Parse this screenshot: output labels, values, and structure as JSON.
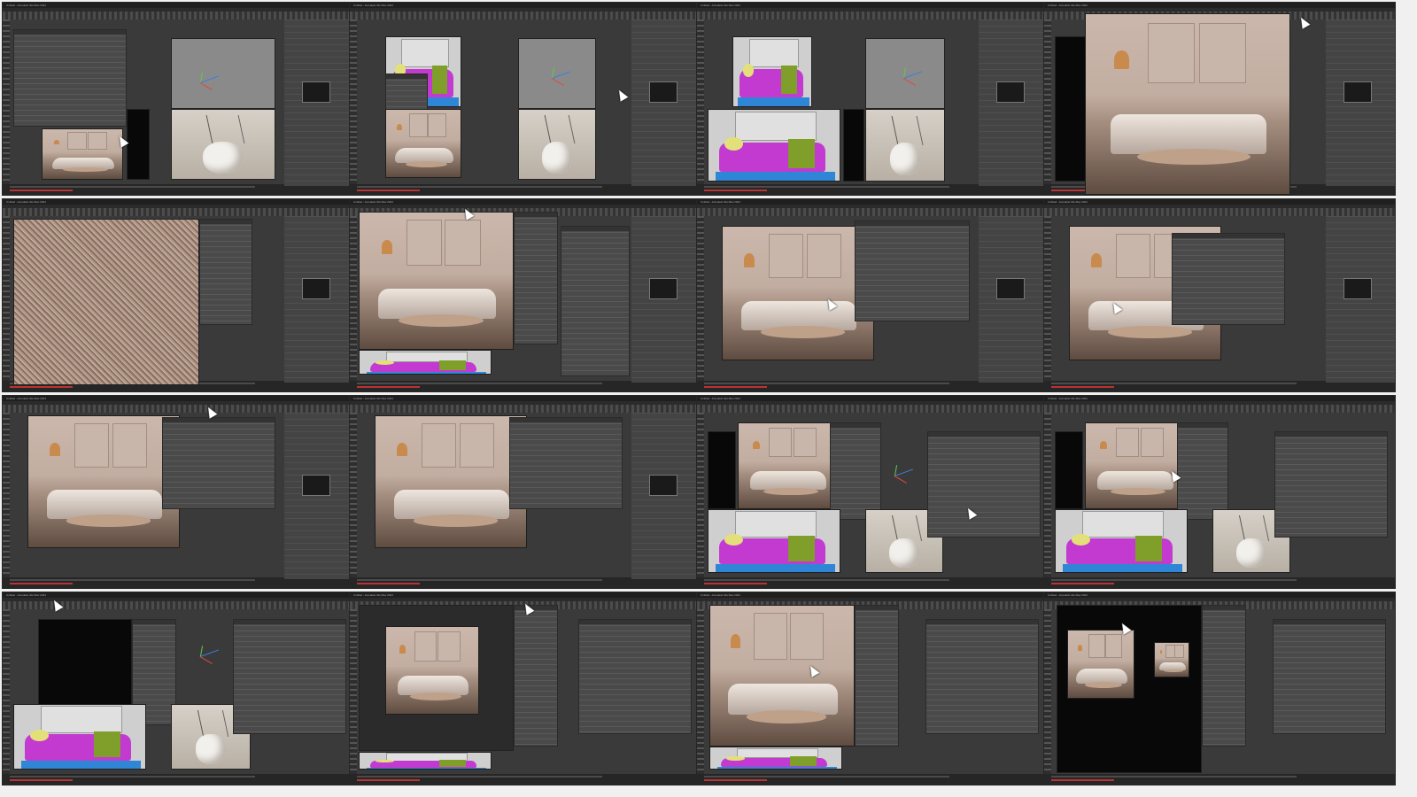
{
  "sheet": {
    "rows": 4,
    "cols": 4
  },
  "app": {
    "title_bar_text": "Untitled - Autodesk 3ds Max 2024"
  },
  "colors": {
    "ui_background": "#3a3a3a",
    "title_bar": "#1f1f1f",
    "id_mask_magenta": "#c23ad0",
    "id_mask_green": "#7f9e2a",
    "id_mask_blue": "#2f86d6",
    "render_warm": "#c2aea1",
    "selection_yellow": "#d8c34a"
  },
  "icons": {
    "cursor": "arrow-cursor-icon",
    "gizmo": "transform-gizmo-icon",
    "window_buttons": "window-controls-icon"
  }
}
